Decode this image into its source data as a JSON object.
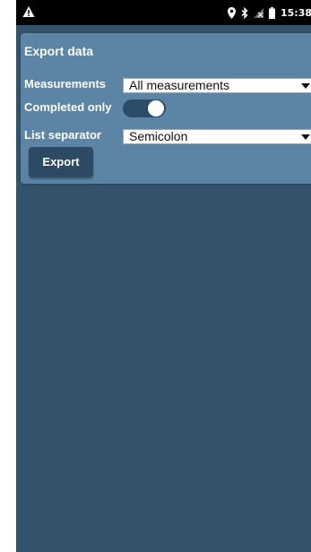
{
  "status_bar": {
    "time": "15:38",
    "icons": [
      "warning-icon",
      "location-icon",
      "bluetooth-icon",
      "no-signal-icon",
      "battery-icon"
    ]
  },
  "panel": {
    "title": "Export data",
    "measurements": {
      "label": "Measurements",
      "selected": "All measurements"
    },
    "completed_only": {
      "label": "Completed only",
      "on": true
    },
    "list_separator": {
      "label": "List separator",
      "selected": "Semicolon"
    },
    "export_button": "Export"
  },
  "colors": {
    "background": "#33536c",
    "panel": "#5c84a5",
    "button": "#2c4a63",
    "toggle_track": "#2b4d6a"
  }
}
